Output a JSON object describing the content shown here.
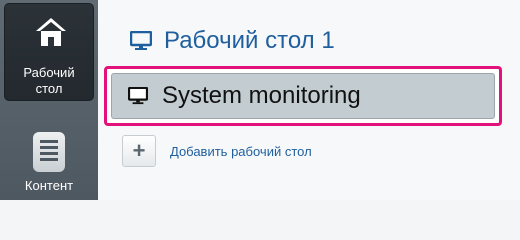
{
  "sidebar": {
    "desktop": {
      "label": "Рабочий\nстол",
      "icon": "home-icon"
    },
    "content": {
      "label": "Контент",
      "icon": "document-icon"
    }
  },
  "desktops": [
    {
      "label": "Рабочий стол 1",
      "icon": "monitor-icon"
    },
    {
      "label": "System monitoring",
      "icon": "monitor-icon",
      "selected": true
    }
  ],
  "add_desktop": {
    "label": "Добавить рабочий стол",
    "icon": "plus-icon"
  },
  "colors": {
    "link": "#1f5f9e",
    "highlight": "#e2127a",
    "rail": "#4e5860"
  }
}
